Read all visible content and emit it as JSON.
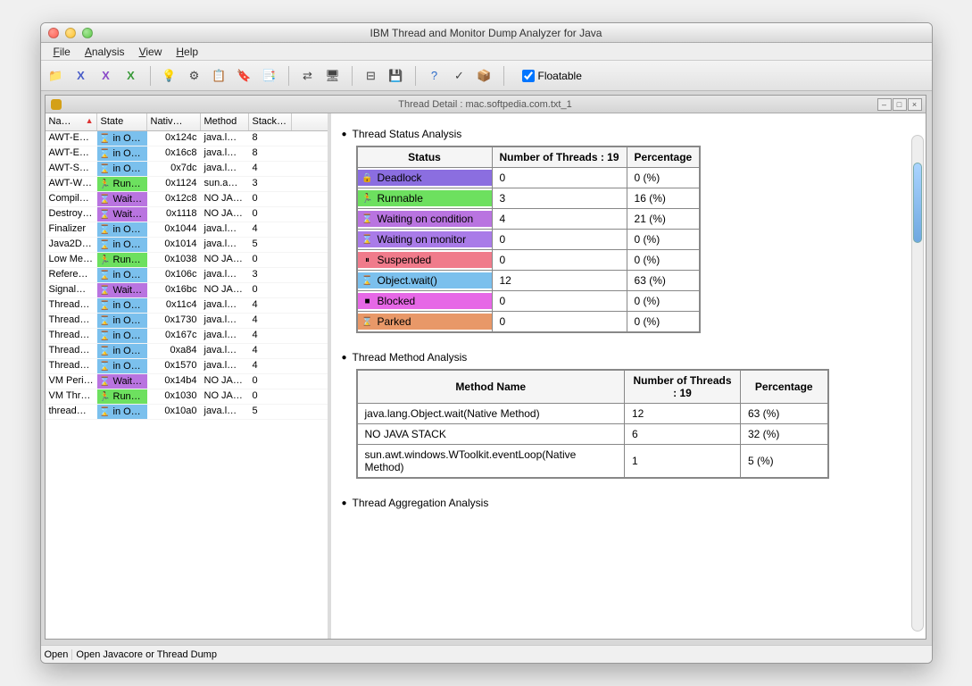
{
  "window": {
    "title": "IBM Thread and Monitor Dump Analyzer for Java"
  },
  "menu": {
    "items": [
      "File",
      "Analysis",
      "View",
      "Help"
    ]
  },
  "toolbar": {
    "icons": [
      "folder-open",
      "x-blue",
      "x-purple",
      "x-green",
      "lightbulb",
      "gear",
      "copy",
      "tag",
      "pages",
      "arrows",
      "screen",
      "minus-square",
      "disk",
      "help",
      "check",
      "box"
    ],
    "floatable_label": "Floatable"
  },
  "inner": {
    "title": "Thread Detail : mac.softpedia.com.txt_1"
  },
  "table": {
    "headers": {
      "name": "Na…",
      "state": "State",
      "native": "Nativ…",
      "method": "Method",
      "stack": "Stack…"
    },
    "rows": [
      {
        "name": "AWT-E…",
        "state": "in O…",
        "stype": "obj",
        "native": "0x124c",
        "method": "java.l…",
        "stack": "8"
      },
      {
        "name": "AWT-E…",
        "state": "in O…",
        "stype": "obj",
        "native": "0x16c8",
        "method": "java.l…",
        "stack": "8"
      },
      {
        "name": "AWT-S…",
        "state": "in O…",
        "stype": "obj",
        "native": "0x7dc",
        "method": "java.l…",
        "stack": "4"
      },
      {
        "name": "AWT-W…",
        "state": "Run…",
        "stype": "run",
        "native": "0x1124",
        "method": "sun.a…",
        "stack": "3"
      },
      {
        "name": "Compil…",
        "state": "Wait…",
        "stype": "wait",
        "native": "0x12c8",
        "method": "NO JA…",
        "stack": "0"
      },
      {
        "name": "Destroy…",
        "state": "Wait…",
        "stype": "wait",
        "native": "0x1118",
        "method": "NO JA…",
        "stack": "0"
      },
      {
        "name": "Finalizer",
        "state": "in O…",
        "stype": "obj",
        "native": "0x1044",
        "method": "java.l…",
        "stack": "4"
      },
      {
        "name": "Java2D…",
        "state": "in O…",
        "stype": "obj",
        "native": "0x1014",
        "method": "java.l…",
        "stack": "5"
      },
      {
        "name": "Low Me…",
        "state": "Run…",
        "stype": "run",
        "native": "0x1038",
        "method": "NO JA…",
        "stack": "0"
      },
      {
        "name": "Refere…",
        "state": "in O…",
        "stype": "obj",
        "native": "0x106c",
        "method": "java.l…",
        "stack": "3"
      },
      {
        "name": "Signal…",
        "state": "Wait…",
        "stype": "wait",
        "native": "0x16bc",
        "method": "NO JA…",
        "stack": "0"
      },
      {
        "name": "Thread…",
        "state": "in O…",
        "stype": "obj",
        "native": "0x11c4",
        "method": "java.l…",
        "stack": "4"
      },
      {
        "name": "Thread…",
        "state": "in O…",
        "stype": "obj",
        "native": "0x1730",
        "method": "java.l…",
        "stack": "4"
      },
      {
        "name": "Thread…",
        "state": "in O…",
        "stype": "obj",
        "native": "0x167c",
        "method": "java.l…",
        "stack": "4"
      },
      {
        "name": "Thread…",
        "state": "in O…",
        "stype": "obj",
        "native": "0xa84",
        "method": "java.l…",
        "stack": "4"
      },
      {
        "name": "Thread…",
        "state": "in O…",
        "stype": "obj",
        "native": "0x1570",
        "method": "java.l…",
        "stack": "4"
      },
      {
        "name": "VM Peri…",
        "state": "Wait…",
        "stype": "wait",
        "native": "0x14b4",
        "method": "NO JA…",
        "stack": "0"
      },
      {
        "name": "VM Thr…",
        "state": "Run…",
        "stype": "run",
        "native": "0x1030",
        "method": "NO JA…",
        "stack": "0"
      },
      {
        "name": "thread…",
        "state": "in O…",
        "stype": "obj",
        "native": "0x10a0",
        "method": "java.l…",
        "stack": "5"
      }
    ]
  },
  "analysis": {
    "status_title": "Thread Status Analysis",
    "method_title": "Thread Method Analysis",
    "aggregation_title": "Thread Aggregation Analysis",
    "status_header": {
      "c1": "Status",
      "c2": "Number of Threads : 19",
      "c3": "Percentage"
    },
    "status_rows": [
      {
        "label": "Deadlock",
        "cls": "st-dead",
        "count": "0",
        "pct": "0 (%)",
        "icon": "🔒"
      },
      {
        "label": "Runnable",
        "cls": "st-run",
        "count": "3",
        "pct": "16 (%)",
        "icon": "🏃"
      },
      {
        "label": "Waiting on condition",
        "cls": "st-wait",
        "count": "4",
        "pct": "21 (%)",
        "icon": "⌛"
      },
      {
        "label": "Waiting on monitor",
        "cls": "st-mon",
        "count": "0",
        "pct": "0 (%)",
        "icon": "⌛"
      },
      {
        "label": "Suspended",
        "cls": "st-susp",
        "count": "0",
        "pct": "0 (%)",
        "icon": "⏸"
      },
      {
        "label": "Object.wait()",
        "cls": "st-obj",
        "count": "12",
        "pct": "63 (%)",
        "icon": "⌛"
      },
      {
        "label": "Blocked",
        "cls": "st-block",
        "count": "0",
        "pct": "0 (%)",
        "icon": "■"
      },
      {
        "label": "Parked",
        "cls": "st-park",
        "count": "0",
        "pct": "0 (%)",
        "icon": "⌛"
      }
    ],
    "method_header": {
      "c1": "Method Name",
      "c2": "Number of Threads : 19",
      "c3": "Percentage"
    },
    "method_rows": [
      {
        "name": "java.lang.Object.wait(Native Method)",
        "count": "12",
        "pct": "63 (%)"
      },
      {
        "name": "NO JAVA STACK",
        "count": "6",
        "pct": "32 (%)"
      },
      {
        "name": "sun.awt.windows.WToolkit.eventLoop(Native Method)",
        "count": "1",
        "pct": "5 (%)"
      }
    ]
  },
  "statusbar": {
    "left": "Open",
    "right": "Open Javacore or Thread Dump"
  }
}
